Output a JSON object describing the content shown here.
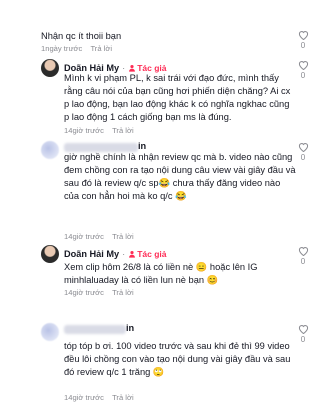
{
  "comments": [
    {
      "text": "Nhận qc ít thoii bạn",
      "time": "1ngày trước",
      "reply": "Trả lời",
      "likes": "0"
    },
    {
      "author": "Doãn Hải My",
      "author_label": "Tác giả",
      "text": "Mình k vi phạm PL, k sai trái với đạo đức, mình thấy rằng câu nói của bạn cũng hơi phiến diện chăng? Ai cx p lao động, bạn lao động khác k có nghĩa ngkhac cũng p lao động 1 cách giống bạn ms là đúng.",
      "time": "14giờ trước",
      "reply": "Trả lời",
      "likes": "0"
    },
    {
      "author_suffix": "in",
      "text": "giờ nghề chính là nhận review qc mà b. video nào cũng đem chồng con ra tạo nội dung câu view vài giây đầu và sau đó là review q/c sp😂 chưa thấy đăng video nào của con hẳn hoi mà ko q/c 😂",
      "time": "14giờ trước",
      "reply": "Trả lời",
      "likes": "0"
    },
    {
      "author": "Doãn Hải My",
      "author_label": "Tác giả",
      "text": "Xem clip hôm 26/8 là có liền nè 😑  hoặc lên IG minhlaluaday là có liền lun nè bạn 😊",
      "time": "14giờ trước",
      "reply": "Trả lời",
      "likes": "0"
    },
    {
      "author_suffix": "in",
      "text": "tóp tóp b ơi. 100 video trước và sau khi đẻ thì 99 video đều lôi chồng con vào tạo nội dung vài giây đầu và sau đó review q/c 1 trăng 🙄",
      "time": "14giờ trước",
      "reply": "Trả lời",
      "likes": "0"
    }
  ],
  "colors": {
    "author_tag": "#fe2c55",
    "meta": "#8a8b91",
    "text": "#161823"
  },
  "icons": {
    "like": "heart-outline-icon",
    "author": "author-badge-icon"
  }
}
